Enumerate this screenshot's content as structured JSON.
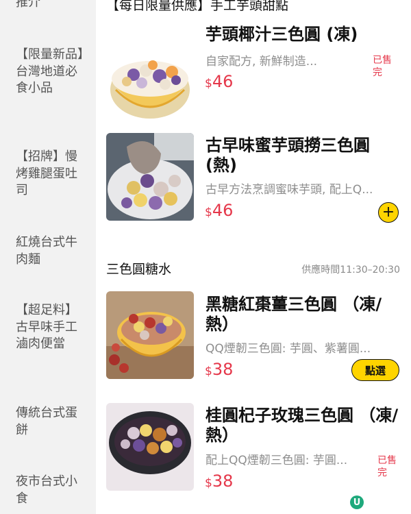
{
  "sidebar": {
    "items": [
      {
        "label": "推介"
      },
      {
        "label": "【限量新品】台灣地道必食小品"
      },
      {
        "label": "【招牌】慢烤雞腿蛋吐司"
      },
      {
        "label": "紅燒台式牛肉麵"
      },
      {
        "label": "【超足料】古早味手工滷肉便當"
      },
      {
        "label": "傳統台式蛋餅"
      },
      {
        "label": "夜市台式小食"
      }
    ]
  },
  "sections": [
    {
      "title": "【每日限量供應】手工芋頭甜點"
    },
    {
      "title": "三色圓糖水",
      "hours": "供應時間11:30–20:30"
    }
  ],
  "products": [
    {
      "name": "芋頭椰汁三色圓 (凍)",
      "desc": "自家配方, 新鮮制造...",
      "currency": "$",
      "price": "46",
      "status": "已售完",
      "image": "taro-coconut-bowl"
    },
    {
      "name": "古早味蜜芋頭撈三色圓 (熱)",
      "desc": "古早方法烹調蜜味芋頭, 配上Q...",
      "currency": "$",
      "price": "46",
      "action": "+",
      "image": "honey-taro-plate"
    },
    {
      "name": "黑糖紅棗薑三色圓 （凍/熱）",
      "desc": "QQ煙韌三色圓: 芋圓、紫薯圓...",
      "currency": "$",
      "price": "38",
      "action": "點選",
      "image": "brown-sugar-date-bowl"
    },
    {
      "name": "桂圓杞子玫瑰三色圓 （凍/熱）",
      "desc": "配上QQ煙韌三色圓: 芋圓...",
      "currency": "$",
      "price": "38",
      "status": "已售完",
      "image": "longan-goji-bowl"
    }
  ],
  "colors": {
    "accent": "#ffd400",
    "price": "#e5374a",
    "sidebar_bg": "#f2f2f2"
  },
  "brand": {
    "logo_text": "U"
  }
}
